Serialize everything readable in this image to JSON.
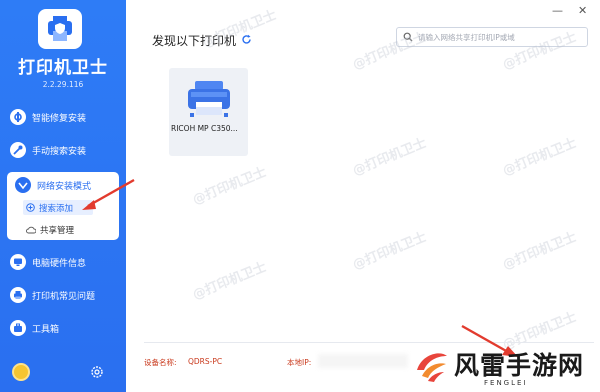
{
  "app": {
    "title": "打印机卫士",
    "version": "2.2.29.116"
  },
  "sidebar": {
    "items": [
      {
        "label": "智能修复安装"
      },
      {
        "label": "手动搜索安装"
      },
      {
        "label": "网络安装模式"
      },
      {
        "label": "电脑硬件信息"
      },
      {
        "label": "打印机常见问题"
      },
      {
        "label": "工具箱"
      }
    ],
    "submenu": [
      {
        "label": "搜索添加",
        "active": true
      },
      {
        "label": "共享管理",
        "active": false
      }
    ]
  },
  "main": {
    "title": "发现以下打印机",
    "search_placeholder": "请输入网络共享打印机IP或域",
    "printers": [
      {
        "name": "RICOH MP C350..."
      }
    ]
  },
  "footer": {
    "device_label": "设备名称:",
    "device_value": "QDRS-PC",
    "ip_label": "本地IP:"
  },
  "watermarks": [
    "@打印机卫士"
  ],
  "brand": {
    "name": "风雷手游网",
    "sub": "FENGLEI"
  },
  "colors": {
    "sidebar": "#2a6ff0",
    "accent": "#2a6ff0",
    "footer_text": "#c9391c",
    "arrow": "#e23b2e"
  }
}
